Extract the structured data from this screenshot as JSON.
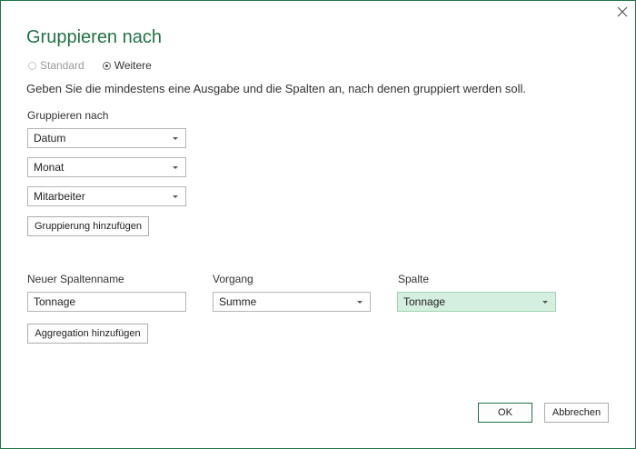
{
  "dialog": {
    "title": "Gruppieren nach",
    "close_glyph": "✕"
  },
  "mode": {
    "options": [
      {
        "label": "Standard",
        "checked": false,
        "disabled": true
      },
      {
        "label": "Weitere",
        "checked": true,
        "disabled": false
      }
    ]
  },
  "description": "Geben Sie die mindestens eine Ausgabe und die Spalten an, nach denen gruppiert werden soll.",
  "grouping": {
    "label": "Gruppieren nach",
    "columns": [
      "Datum",
      "Monat",
      "Mitarbeiter"
    ],
    "add_button": "Gruppierung hinzufügen"
  },
  "aggregation": {
    "headers": {
      "name": "Neuer Spaltenname",
      "operation": "Vorgang",
      "column": "Spalte"
    },
    "rows": [
      {
        "name": "Tonnage",
        "operation": "Summe",
        "column": "Tonnage"
      }
    ],
    "add_button": "Aggregation hinzufügen"
  },
  "footer": {
    "ok": "OK",
    "cancel": "Abbrechen"
  },
  "colors": {
    "accent": "#217346",
    "highlight": "#d4efdf"
  }
}
